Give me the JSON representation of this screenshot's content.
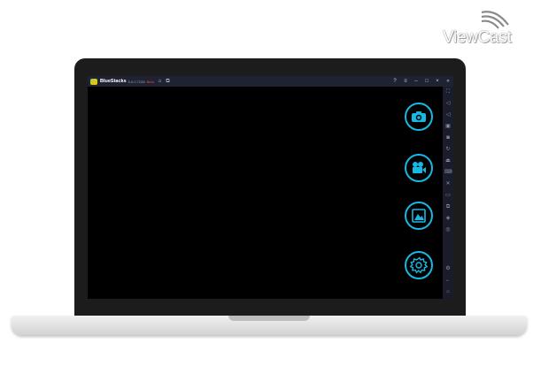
{
  "logo": {
    "text": "ViewCast"
  },
  "window": {
    "app_name": "BlueStacks",
    "version": "5.0.0.7228",
    "beta": "Beta"
  },
  "colors": {
    "accent": "#16b9e6",
    "titlebar": "#1f2233",
    "sidebar": "#1a1c2c"
  },
  "titlebar_icons": [
    "home-icon",
    "multi-instance-icon",
    "help-icon",
    "menu-icon",
    "minimize-icon",
    "restore-icon",
    "close-icon",
    "expand-sidebar-icon"
  ],
  "camera_app": {
    "buttons": [
      "camera-capture-icon",
      "video-record-icon",
      "gallery-icon",
      "settings-icon"
    ]
  }
}
